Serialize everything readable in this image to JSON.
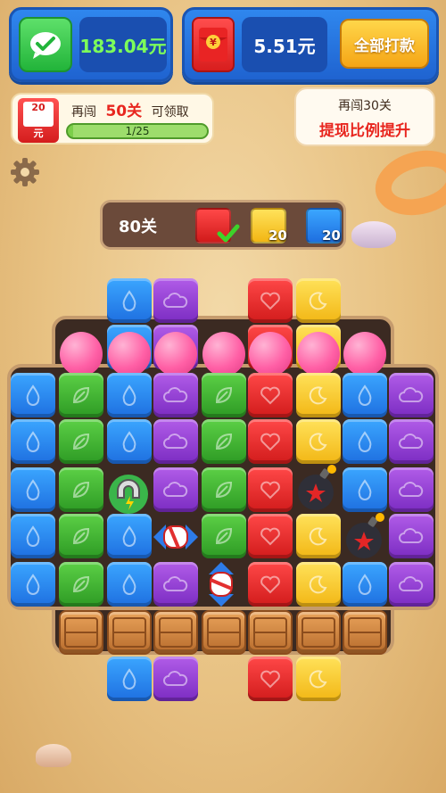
{
  "wallet": {
    "balance": "183.04元",
    "icon": "wechat-icon"
  },
  "redpacket": {
    "balance": "5.51元",
    "withdraw_all_label": "全部打款",
    "icon": "red-envelope-icon"
  },
  "level_progress": {
    "envelope_amount": "20",
    "envelope_unit": "元",
    "prefix": "再闯",
    "levels_needed": "50关",
    "suffix": "可领取",
    "progress_text": "1/25",
    "progress_fraction": 0.04
  },
  "promo_bubble": {
    "line1": "再闯30关",
    "line2": "提现比例提升"
  },
  "goals": {
    "level_label": "80关",
    "items": [
      {
        "color": "red",
        "count": "",
        "done": true
      },
      {
        "color": "yellow",
        "count": "20"
      },
      {
        "color": "blue",
        "count": "20"
      }
    ]
  },
  "colors": {
    "blue": "#1e6fe0",
    "green": "#2d9a24",
    "purple": "#7b2cc2",
    "red": "#d11b1b",
    "yellow": "#f2b614",
    "accent_red": "#e8261f"
  }
}
